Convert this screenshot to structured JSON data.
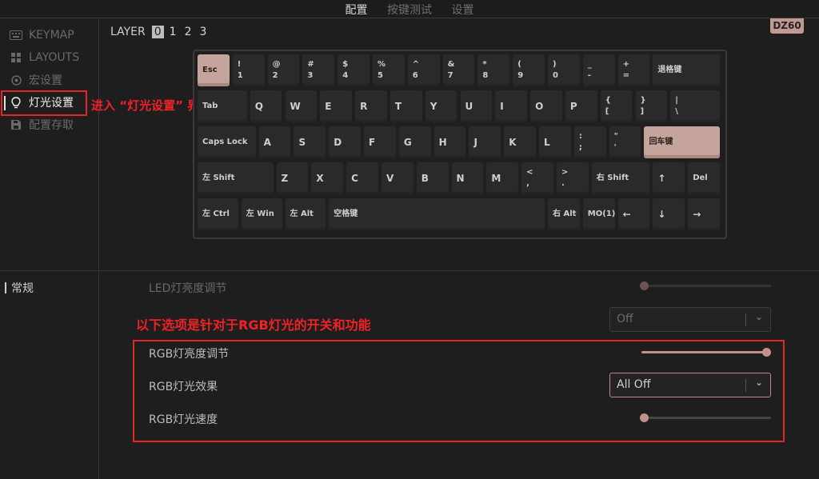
{
  "topbar": {
    "tabs": [
      "配置",
      "按键测试",
      "设置"
    ]
  },
  "sidebar": {
    "items": [
      {
        "label": "KEYMAP",
        "icon": "keyboard-icon"
      },
      {
        "label": "LAYOUTS",
        "icon": "layouts-icon"
      },
      {
        "label": "宏设置",
        "icon": "macro-icon"
      },
      {
        "label": "灯光设置",
        "icon": "lightbulb-icon"
      },
      {
        "label": "配置存取",
        "icon": "save-icon"
      }
    ]
  },
  "annotations": {
    "lighting_note": "进入 “灯光设置” 界面",
    "rgb_note": "以下选项是针对于RGB灯光的开关和功能"
  },
  "layer": {
    "label": "LAYER",
    "values": [
      "0",
      "1",
      "2",
      "3"
    ],
    "selected": "0"
  },
  "device_badge": "DZ60",
  "keyboard": {
    "row1": [
      "Esc",
      "!\n1",
      "@\n2",
      "#\n3",
      "$\n4",
      "%\n5",
      "^\n6",
      "&\n7",
      "*\n8",
      "(\n9",
      ")\n0",
      "_\n-",
      "+\n=",
      "退格键"
    ],
    "row2": [
      "Tab",
      "Q",
      "W",
      "E",
      "R",
      "T",
      "Y",
      "U",
      "I",
      "O",
      "P",
      "{\n[",
      "}\n]",
      "|\n\\"
    ],
    "row3": [
      "Caps Lock",
      "A",
      "S",
      "D",
      "F",
      "G",
      "H",
      "J",
      "K",
      "L",
      ":\n;",
      "\"\n'",
      "回车键"
    ],
    "row4": [
      "左 Shift",
      "Z",
      "X",
      "C",
      "V",
      "B",
      "N",
      "M",
      "<\n,",
      ">\n.",
      "右 Shift",
      "↑",
      "Del"
    ],
    "row5": [
      "左 Ctrl",
      "左 Win",
      "左 Alt",
      "空格键",
      "右 Alt",
      "MO(1)",
      "←",
      "↓",
      "→"
    ]
  },
  "lighting": {
    "section_label": "常规",
    "led_brightness": {
      "label": "LED灯亮度调节",
      "value": 0
    },
    "led_effect": {
      "value": "Off"
    },
    "rgb_brightness": {
      "label": "RGB灯亮度调节",
      "value": 1.0
    },
    "rgb_effect": {
      "label": "RGB灯光效果",
      "value": "All Off"
    },
    "rgb_speed": {
      "label": "RGB灯光速度",
      "value": 0
    }
  },
  "colors": {
    "accent": "#c5a49b",
    "annotation_red": "#e3262b"
  }
}
